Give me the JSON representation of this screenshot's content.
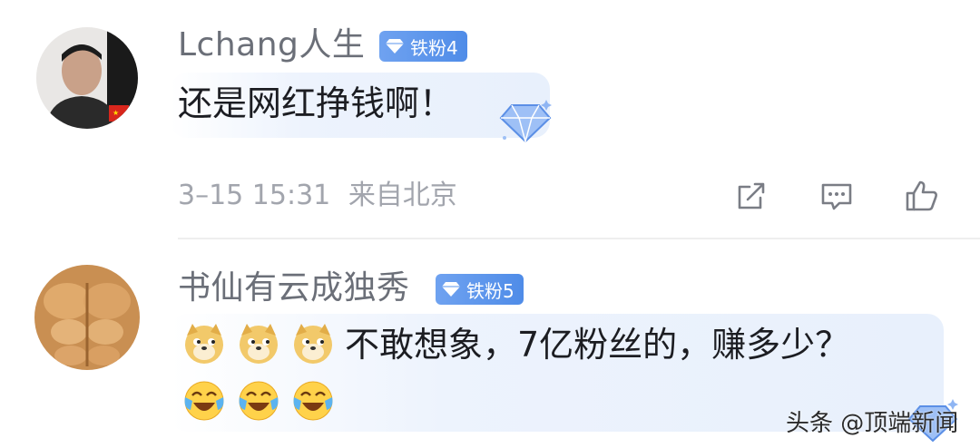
{
  "comments": [
    {
      "username": "Lchang人生",
      "badge": "铁粉4",
      "text": "还是网红挣钱啊！",
      "timestamp": "3–15 15:31",
      "location": "来自北京",
      "actions": [
        "share-icon",
        "reply-icon",
        "like-icon"
      ]
    },
    {
      "username": "书仙有云成独秀",
      "badge": "铁粉5",
      "emojis_before": [
        "doge-emoji",
        "doge-emoji",
        "doge-emoji"
      ],
      "text": "不敢想象，7亿粉丝的，赚多少？",
      "emojis_after": [
        "laugh-cry-emoji",
        "laugh-cry-emoji",
        "laugh-cry-emoji"
      ]
    }
  ],
  "watermark": "头条 @顶端新闻",
  "colors": {
    "badge": "#5a94ec",
    "bubble": "#e8f0fc",
    "username": "#6b6f78",
    "meta": "#a2a5ad"
  }
}
